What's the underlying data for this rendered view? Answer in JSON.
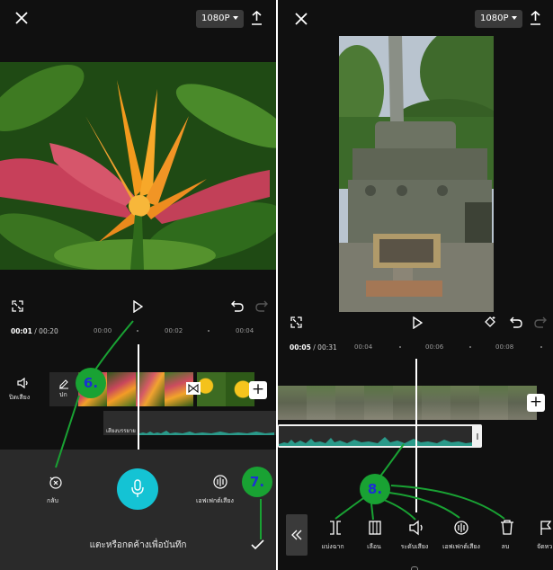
{
  "left": {
    "resolution": "1080P",
    "time_current": "00:01",
    "time_total": " / 00:20",
    "ticks": [
      "00:00",
      "00:02",
      "00:04"
    ],
    "mute_label": "ปิดเสียง",
    "clip_label": "ปก",
    "audio_clip_label": "เสียงบรรยาย",
    "back_label": "กลับ",
    "voice_effect_label": "เอฟเฟกต์เสียง",
    "record_hint": "แตะหรือกดค้างเพื่อบันทึก",
    "step6": "6.",
    "step7": "7."
  },
  "right": {
    "resolution": "1080P",
    "time_current": "00:05",
    "time_total": " / 00:31",
    "ticks": [
      "00:04",
      "00:06",
      "00:08"
    ],
    "step8": "8.",
    "toolbar": [
      {
        "label": "แบ่งฉาก",
        "icon": "split-icon"
      },
      {
        "label": "เลือน",
        "icon": "blur-icon"
      },
      {
        "label": "ระดับเสียง",
        "icon": "volume-icon"
      },
      {
        "label": "เอฟเฟกต์เสียง",
        "icon": "voice-effect-icon"
      },
      {
        "label": "ลบ",
        "icon": "delete-icon"
      },
      {
        "label": "จัดหว",
        "icon": "flag-icon"
      }
    ]
  },
  "colors": {
    "accent": "#14c3d4",
    "annotation_green": "#19a233",
    "annotation_text": "#1c2fd4",
    "waveform": "#2a9a8a"
  }
}
